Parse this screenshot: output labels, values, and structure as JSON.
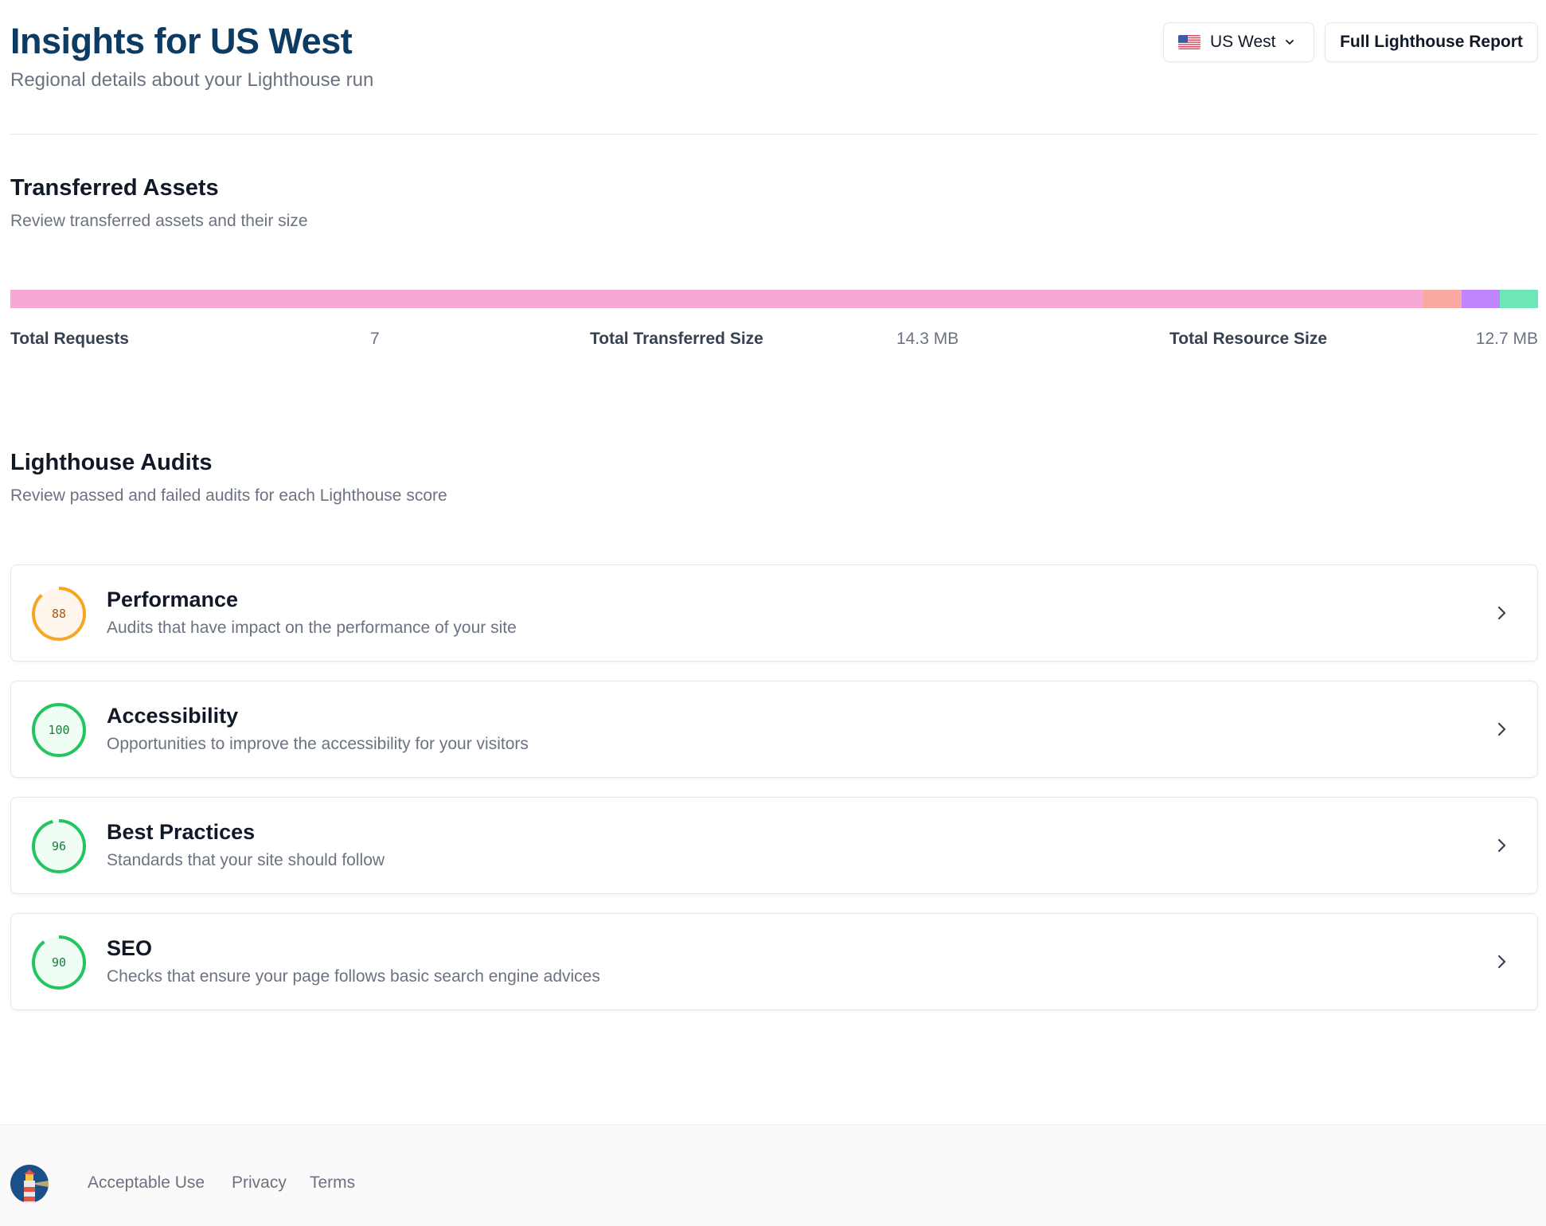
{
  "header": {
    "title": "Insights for US West",
    "subtitle": "Regional details about your Lighthouse run",
    "region_select": {
      "value": "US West",
      "flag_icon": "us-flag-icon"
    },
    "full_report_label": "Full Lighthouse Report"
  },
  "assets": {
    "title": "Transferred Assets",
    "subtitle": "Review transferred assets and their size",
    "bar_segments": [
      {
        "color": "#f7a8d4",
        "fraction": 0.925
      },
      {
        "color": "#f8a9a0",
        "fraction": 0.025
      },
      {
        "color": "#c084fc",
        "fraction": 0.025
      },
      {
        "color": "#6ee7b7",
        "fraction": 0.025
      }
    ],
    "stats": {
      "total_requests_label": "Total Requests",
      "total_requests_value": "7",
      "total_transferred_label": "Total Transferred Size",
      "total_transferred_value": "14.3 MB",
      "total_resource_label": "Total Resource Size",
      "total_resource_value": "12.7 MB"
    }
  },
  "audits": {
    "title": "Lighthouse Audits",
    "subtitle": "Review passed and failed audits for each Lighthouse score",
    "items": [
      {
        "score": "88",
        "score_value": 88,
        "title": "Performance",
        "description": "Audits that have impact on the performance of your site",
        "ring_color": "#f5a623",
        "text_color": "#b45309",
        "fill_color": "#fff7ed"
      },
      {
        "score": "100",
        "score_value": 100,
        "title": "Accessibility",
        "description": "Opportunities to improve the accessibility for your visitors",
        "ring_color": "#22c55e",
        "text_color": "#15803d",
        "fill_color": "#f0fdf4"
      },
      {
        "score": "96",
        "score_value": 96,
        "title": "Best Practices",
        "description": "Standards that your site should follow",
        "ring_color": "#22c55e",
        "text_color": "#15803d",
        "fill_color": "#f0fdf4"
      },
      {
        "score": "90",
        "score_value": 90,
        "title": "SEO",
        "description": "Checks that ensure your page follows basic search engine advices",
        "ring_color": "#22c55e",
        "text_color": "#15803d",
        "fill_color": "#f0fdf4"
      }
    ]
  },
  "footer": {
    "logo_icon": "lighthouse-logo-icon",
    "links": [
      "Acceptable Use",
      "Privacy",
      "Terms"
    ]
  }
}
